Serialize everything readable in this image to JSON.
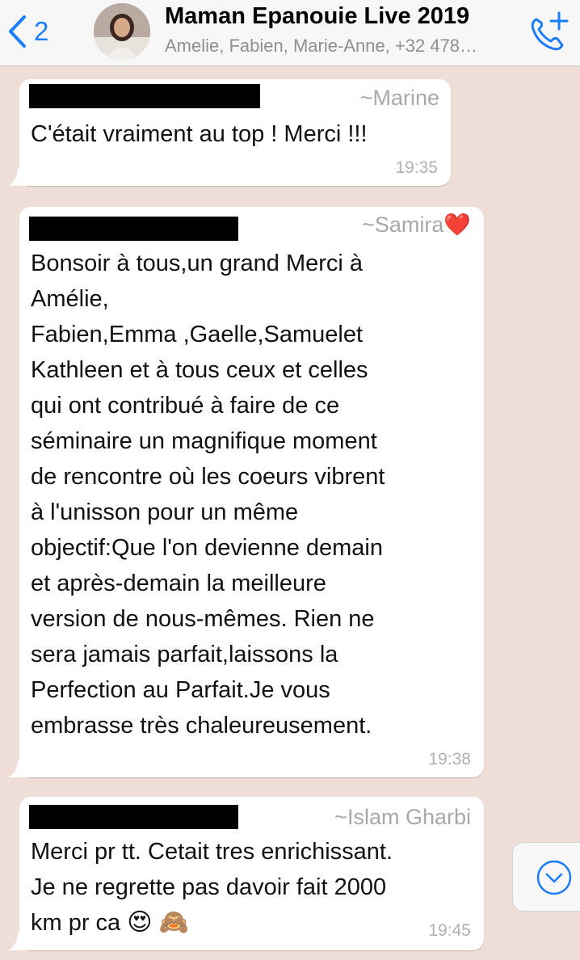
{
  "header": {
    "back_count": "2",
    "title": "Maman Epanouie Live 2019",
    "subtitle": "Amelie, Fabien, Marie-Anne, +32 478…"
  },
  "messages": [
    {
      "sender": "~Marine",
      "text": "C'était vraiment au top ! Merci !!!",
      "time": "19:35"
    },
    {
      "sender": "~Samira",
      "sender_emoji": "❤️",
      "lines": [
        "Bonsoir à tous,un grand Merci à",
        "Amélie,",
        "Fabien,Emma ,Gaelle,Samuelet",
        "Kathleen et à tous ceux et celles",
        "qui ont contribué à faire de ce",
        "séminaire un magnifique moment",
        "de rencontre où les coeurs vibrent",
        "à l'unisson pour un même",
        "objectif:Que l'on devienne demain",
        "et après-demain la meilleure",
        "version de nous-mêmes. Rien ne",
        "sera jamais parfait,laissons la",
        "Perfection au Parfait.Je vous",
        "embrasse très chaleureusement."
      ],
      "time": "19:38"
    },
    {
      "sender": "~Islam Gharbi",
      "lines": [
        "Merci pr tt. Cetait tres enrichissant.",
        "Je ne regrette pas davoir fait 2000",
        "km pr ca"
      ],
      "emojis": "😍 🙈",
      "time": "19:45"
    }
  ],
  "colors": {
    "background": "#efddd7",
    "accent": "#1a7dfd"
  },
  "icons": {
    "back": "chevron-left-icon",
    "call": "add-call-icon",
    "scroll": "chevron-down-circle-icon"
  }
}
